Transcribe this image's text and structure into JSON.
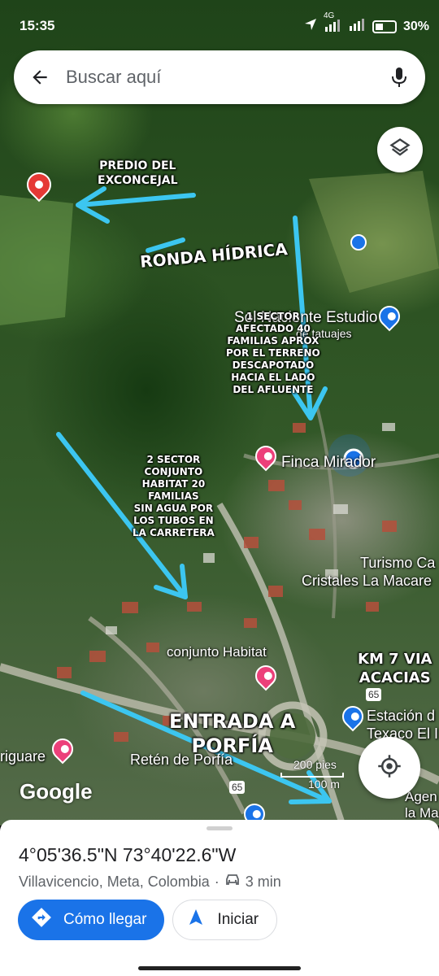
{
  "status_bar": {
    "time": "15:35",
    "network": "4G",
    "battery": "30%"
  },
  "search": {
    "placeholder": "Buscar aquí"
  },
  "annotations": {
    "predio": "PREDIO DEL\nEXCONCEJAL",
    "ronda": "RONDA HÍDRICA",
    "sector1": "1 SECTOR\nAFECTADO 40\nFAMILIAS APROX\nPOR EL TERRENO\nDESCAPOTADO\nHACIA EL LADO\nDEL AFLUENTE",
    "sector2": "2 SECTOR\nCONJUNTO\nHABITAT 20\nFAMILIAS\nSIN AGUA POR\nLOS TUBOS EN\nLA CARRETERA",
    "km7": "KM 7 VIA\nACACIAS",
    "entrada": "ENTRADA A\nPORFÍA"
  },
  "places": {
    "estudio_line1": "Sol Naciente Estudio",
    "estudio_line2": "de tatuajes",
    "finca": "Finca Mirador",
    "turismo_line1": "Turismo Ca",
    "turismo_line2": "Cristales La Macare",
    "habitat": "conjunto Habitat",
    "estacion_line1": "Estación d",
    "estacion_line2": "Texaco El I",
    "riguare": "riguare",
    "reten": "Retén de Porfía",
    "agen_line1": "Agen",
    "agen_line2": "la Ma",
    "route_65": "65",
    "scale_ft": "200 pies",
    "scale_m": "100 m"
  },
  "map_brand": "Google",
  "sheet": {
    "coordinates": "4°05'36.5\"N 73°40'22.6\"W",
    "location": "Villavicencio, Meta, Colombia",
    "separator": "·",
    "drive_time": "3 min",
    "directions_label": "Cómo llegar",
    "start_label": "Iniciar"
  },
  "colors": {
    "accent": "#1a73e8",
    "annotation_arrow": "#3cc6f0",
    "pin_red": "#e53935",
    "pin_pink": "#ec407a"
  }
}
